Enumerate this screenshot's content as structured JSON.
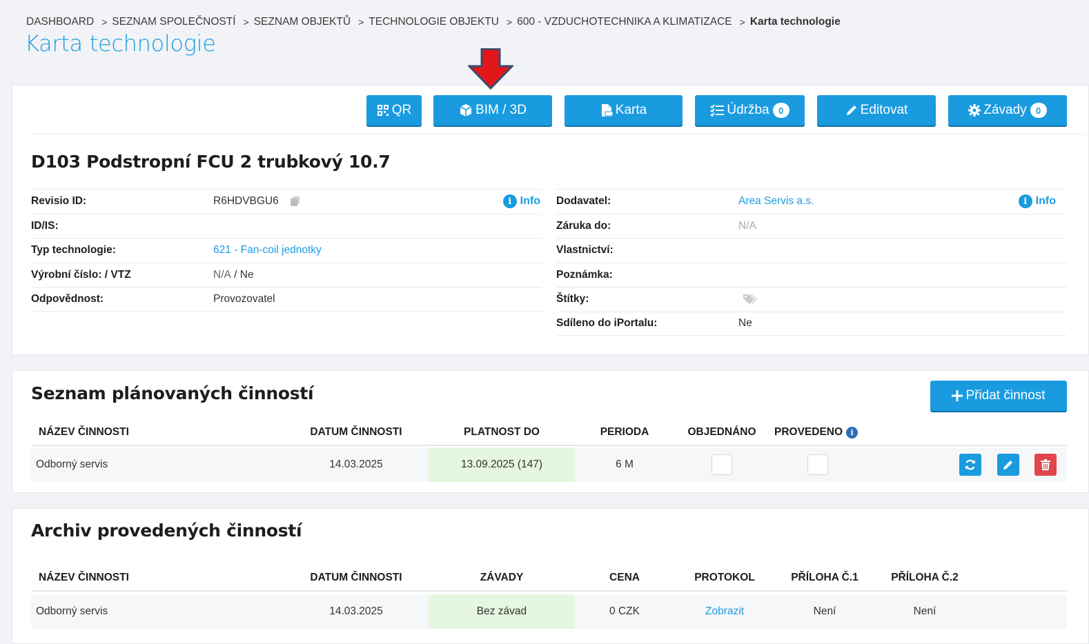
{
  "breadcrumb": {
    "items": [
      "DASHBOARD",
      "SEZNAM SPOLEČNOSTÍ",
      "SEZNAM OBJEKTŮ",
      "TECHNOLOGIE OBJEKTU",
      "600 - VZDUCHOTECHNIKA A KLIMATIZACE"
    ],
    "current": "Karta technologie",
    "separator": ">"
  },
  "page_title": "Karta technologie",
  "toolbar": {
    "qr_label": "QR",
    "bim_label": "BIM / 3D",
    "karta_label": "Karta",
    "udrzba_label": "Údržba",
    "udrzba_count": "0",
    "editovat_label": "Editovat",
    "zavady_label": "Závady",
    "zavady_count": "0"
  },
  "object": {
    "title": "D103 Podstropní FCU 2 trubkový 10.7",
    "left": [
      {
        "label": "Revisio ID:",
        "value": "R6HDVBGU6"
      },
      {
        "label": "ID/IS:",
        "value": ""
      },
      {
        "label": "Typ technologie:",
        "value": "621 - Fan-coil jednotky"
      },
      {
        "label": "Výrobní číslo: / VTZ",
        "value_a": "N/A",
        "value_b": " / Ne"
      },
      {
        "label": "Odpovědnost:",
        "value": "Provozovatel"
      }
    ],
    "right": [
      {
        "label": "Dodavatel:",
        "value": "Area Servis a.s."
      },
      {
        "label": "Záruka do:",
        "value": "N/A"
      },
      {
        "label": "Vlastnictví:",
        "value": ""
      },
      {
        "label": "Poznámka:",
        "value": ""
      },
      {
        "label": "Štítky:",
        "value": ""
      },
      {
        "label": "Sdíleno do iPortalu:",
        "value": "Ne"
      }
    ],
    "info_label": "Info"
  },
  "planned": {
    "title": "Seznam plánovaných činností",
    "add_button": "Přidat činnost",
    "columns": [
      "NÁZEV ČINNOSTI",
      "DATUM ČINNOSTI",
      "PLATNOST DO",
      "PERIODA",
      "OBJEDNÁNO",
      "PROVEDENO"
    ],
    "rows": [
      {
        "name": "Odborný servis",
        "date": "14.03.2025",
        "valid_to": "13.09.2025 (147)",
        "period": "6 M"
      }
    ]
  },
  "archive": {
    "title": "Archiv provedených činností",
    "columns": [
      "NÁZEV ČINNOSTI",
      "DATUM ČINNOSTI",
      "ZÁVADY",
      "CENA",
      "PROTOKOL",
      "PŘÍLOHA Č.1",
      "PŘÍLOHA Č.2"
    ],
    "rows": [
      {
        "name": "Odborný servis",
        "date": "14.03.2025",
        "defects": "Bez závad",
        "price": "0 CZK",
        "protocol": "Zobrazit",
        "att1": "Není",
        "att2": "Není"
      }
    ]
  },
  "colors": {
    "accent": "#1a9be0",
    "danger": "#e0474c",
    "valid_bg": "#e5f7df",
    "annotation_arrow": "#e3161b"
  }
}
